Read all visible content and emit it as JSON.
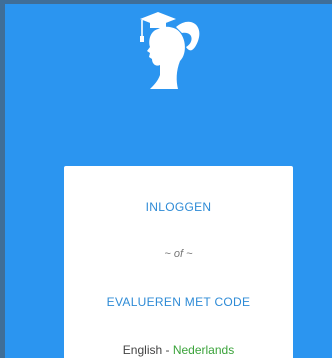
{
  "logo": {
    "icon": "graduate-girl-silhouette-icon"
  },
  "card": {
    "login_label": "INLOGGEN",
    "or_label": "~ of ~",
    "code_label": "EVALUEREN MET CODE",
    "languages": {
      "english": "English",
      "separator": " - ",
      "dutch": "Nederlands"
    }
  },
  "colors": {
    "background": "#2b95f0",
    "link": "#2e8bd6",
    "active_language": "#3aa33a"
  }
}
